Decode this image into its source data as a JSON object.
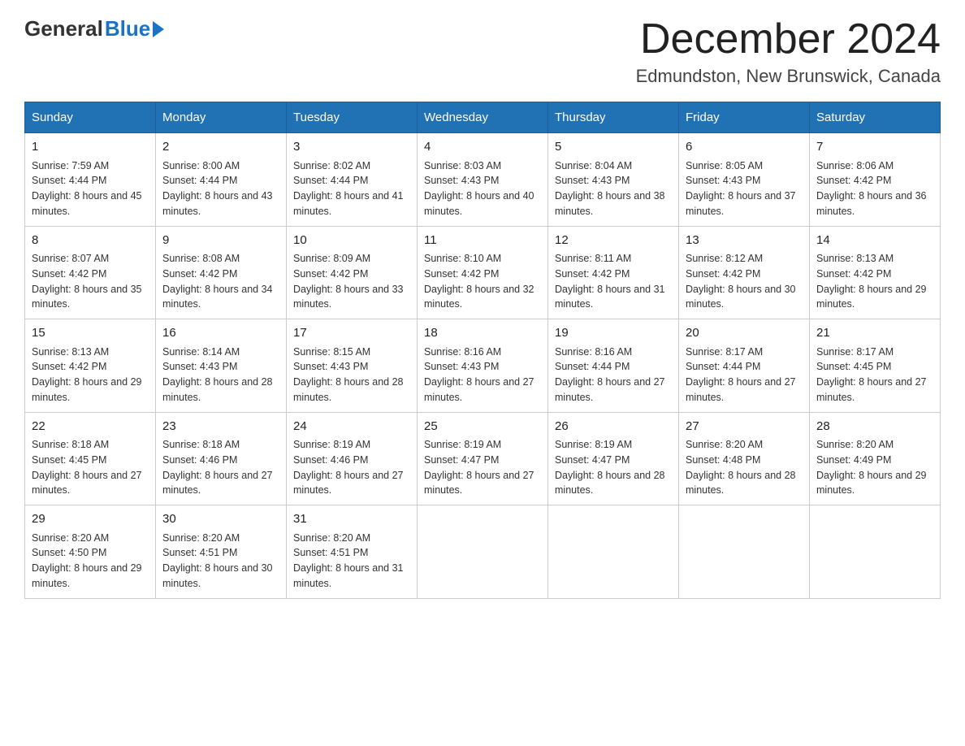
{
  "header": {
    "logo_general": "General",
    "logo_blue": "Blue",
    "month_year": "December 2024",
    "location": "Edmundston, New Brunswick, Canada"
  },
  "days_of_week": [
    "Sunday",
    "Monday",
    "Tuesday",
    "Wednesday",
    "Thursday",
    "Friday",
    "Saturday"
  ],
  "weeks": [
    [
      {
        "day": "1",
        "sunrise": "7:59 AM",
        "sunset": "4:44 PM",
        "daylight": "8 hours and 45 minutes."
      },
      {
        "day": "2",
        "sunrise": "8:00 AM",
        "sunset": "4:44 PM",
        "daylight": "8 hours and 43 minutes."
      },
      {
        "day": "3",
        "sunrise": "8:02 AM",
        "sunset": "4:44 PM",
        "daylight": "8 hours and 41 minutes."
      },
      {
        "day": "4",
        "sunrise": "8:03 AM",
        "sunset": "4:43 PM",
        "daylight": "8 hours and 40 minutes."
      },
      {
        "day": "5",
        "sunrise": "8:04 AM",
        "sunset": "4:43 PM",
        "daylight": "8 hours and 38 minutes."
      },
      {
        "day": "6",
        "sunrise": "8:05 AM",
        "sunset": "4:43 PM",
        "daylight": "8 hours and 37 minutes."
      },
      {
        "day": "7",
        "sunrise": "8:06 AM",
        "sunset": "4:42 PM",
        "daylight": "8 hours and 36 minutes."
      }
    ],
    [
      {
        "day": "8",
        "sunrise": "8:07 AM",
        "sunset": "4:42 PM",
        "daylight": "8 hours and 35 minutes."
      },
      {
        "day": "9",
        "sunrise": "8:08 AM",
        "sunset": "4:42 PM",
        "daylight": "8 hours and 34 minutes."
      },
      {
        "day": "10",
        "sunrise": "8:09 AM",
        "sunset": "4:42 PM",
        "daylight": "8 hours and 33 minutes."
      },
      {
        "day": "11",
        "sunrise": "8:10 AM",
        "sunset": "4:42 PM",
        "daylight": "8 hours and 32 minutes."
      },
      {
        "day": "12",
        "sunrise": "8:11 AM",
        "sunset": "4:42 PM",
        "daylight": "8 hours and 31 minutes."
      },
      {
        "day": "13",
        "sunrise": "8:12 AM",
        "sunset": "4:42 PM",
        "daylight": "8 hours and 30 minutes."
      },
      {
        "day": "14",
        "sunrise": "8:13 AM",
        "sunset": "4:42 PM",
        "daylight": "8 hours and 29 minutes."
      }
    ],
    [
      {
        "day": "15",
        "sunrise": "8:13 AM",
        "sunset": "4:42 PM",
        "daylight": "8 hours and 29 minutes."
      },
      {
        "day": "16",
        "sunrise": "8:14 AM",
        "sunset": "4:43 PM",
        "daylight": "8 hours and 28 minutes."
      },
      {
        "day": "17",
        "sunrise": "8:15 AM",
        "sunset": "4:43 PM",
        "daylight": "8 hours and 28 minutes."
      },
      {
        "day": "18",
        "sunrise": "8:16 AM",
        "sunset": "4:43 PM",
        "daylight": "8 hours and 27 minutes."
      },
      {
        "day": "19",
        "sunrise": "8:16 AM",
        "sunset": "4:44 PM",
        "daylight": "8 hours and 27 minutes."
      },
      {
        "day": "20",
        "sunrise": "8:17 AM",
        "sunset": "4:44 PM",
        "daylight": "8 hours and 27 minutes."
      },
      {
        "day": "21",
        "sunrise": "8:17 AM",
        "sunset": "4:45 PM",
        "daylight": "8 hours and 27 minutes."
      }
    ],
    [
      {
        "day": "22",
        "sunrise": "8:18 AM",
        "sunset": "4:45 PM",
        "daylight": "8 hours and 27 minutes."
      },
      {
        "day": "23",
        "sunrise": "8:18 AM",
        "sunset": "4:46 PM",
        "daylight": "8 hours and 27 minutes."
      },
      {
        "day": "24",
        "sunrise": "8:19 AM",
        "sunset": "4:46 PM",
        "daylight": "8 hours and 27 minutes."
      },
      {
        "day": "25",
        "sunrise": "8:19 AM",
        "sunset": "4:47 PM",
        "daylight": "8 hours and 27 minutes."
      },
      {
        "day": "26",
        "sunrise": "8:19 AM",
        "sunset": "4:47 PM",
        "daylight": "8 hours and 28 minutes."
      },
      {
        "day": "27",
        "sunrise": "8:20 AM",
        "sunset": "4:48 PM",
        "daylight": "8 hours and 28 minutes."
      },
      {
        "day": "28",
        "sunrise": "8:20 AM",
        "sunset": "4:49 PM",
        "daylight": "8 hours and 29 minutes."
      }
    ],
    [
      {
        "day": "29",
        "sunrise": "8:20 AM",
        "sunset": "4:50 PM",
        "daylight": "8 hours and 29 minutes."
      },
      {
        "day": "30",
        "sunrise": "8:20 AM",
        "sunset": "4:51 PM",
        "daylight": "8 hours and 30 minutes."
      },
      {
        "day": "31",
        "sunrise": "8:20 AM",
        "sunset": "4:51 PM",
        "daylight": "8 hours and 31 minutes."
      },
      null,
      null,
      null,
      null
    ]
  ]
}
